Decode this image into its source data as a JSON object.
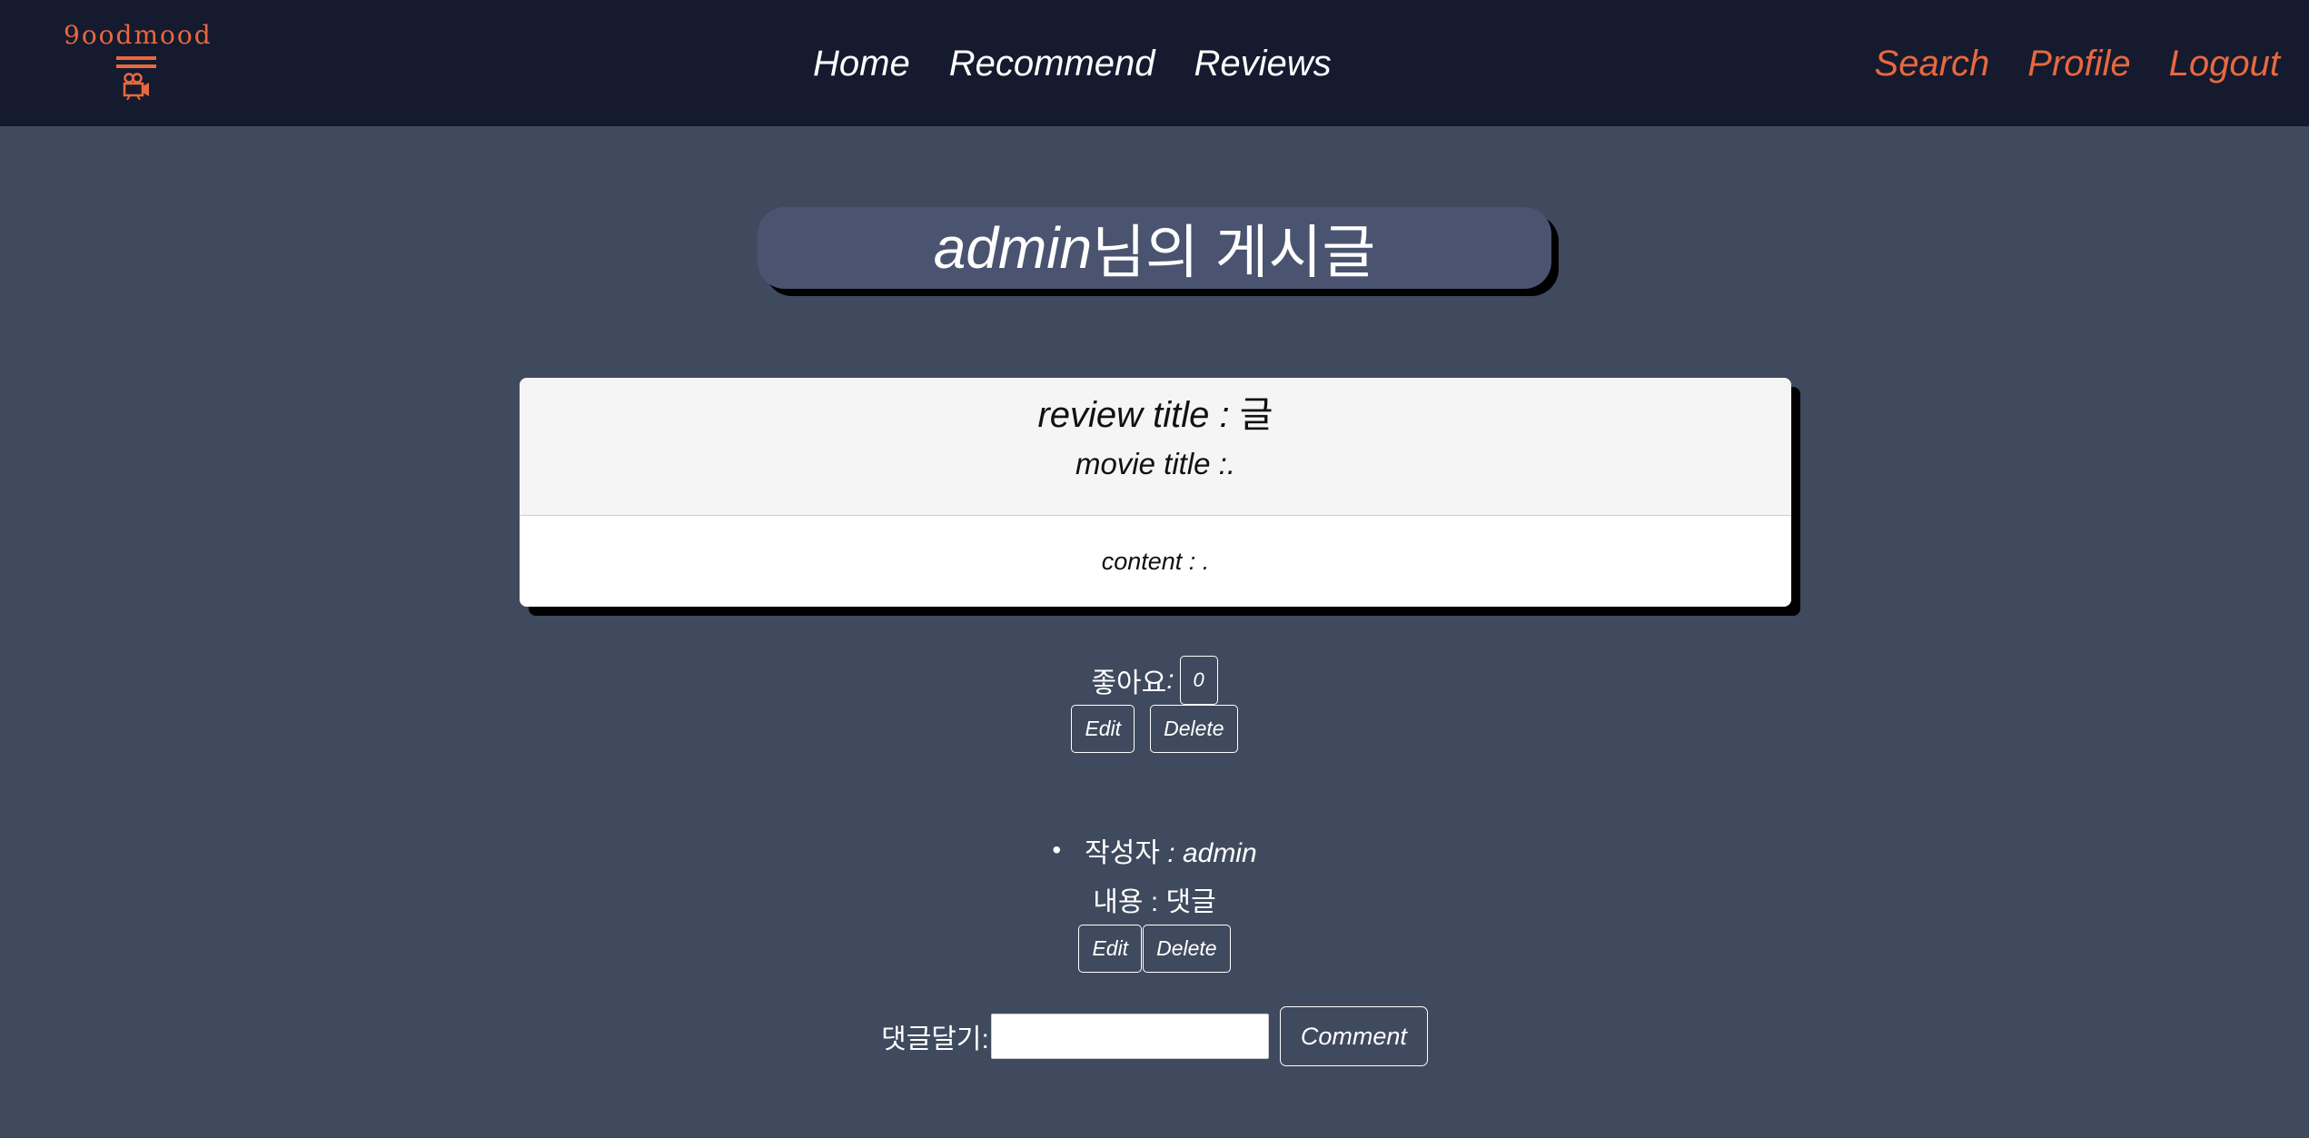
{
  "brand": {
    "name": "9oodmood",
    "camera_icon": "film-camera-icon",
    "accent": "#e8683f"
  },
  "nav": {
    "center": [
      "Home",
      "Recommend",
      "Reviews"
    ],
    "right": [
      "Search",
      "Profile",
      "Logout"
    ]
  },
  "heading": {
    "author": "admin",
    "suffix": "님의 게시글"
  },
  "review": {
    "title_label": "review title :",
    "title_value": "글",
    "movie_label": "movie title :.",
    "content_label": "content : ."
  },
  "likes": {
    "label": "좋아요",
    "colon": ":",
    "count": "0"
  },
  "post_actions": {
    "edit": "Edit",
    "delete": "Delete"
  },
  "comments": [
    {
      "author_label": "작성자",
      "author_value": ": admin",
      "content_label": "내용 :",
      "content_value": "댓글",
      "edit": "Edit",
      "delete": "Delete"
    }
  ],
  "comment_form": {
    "label": "댓글달기:",
    "input_value": "",
    "submit": "Comment"
  },
  "colors": {
    "navbar": "#151a2e",
    "background": "#3f4a5e",
    "heading_box": "#4a5470"
  }
}
